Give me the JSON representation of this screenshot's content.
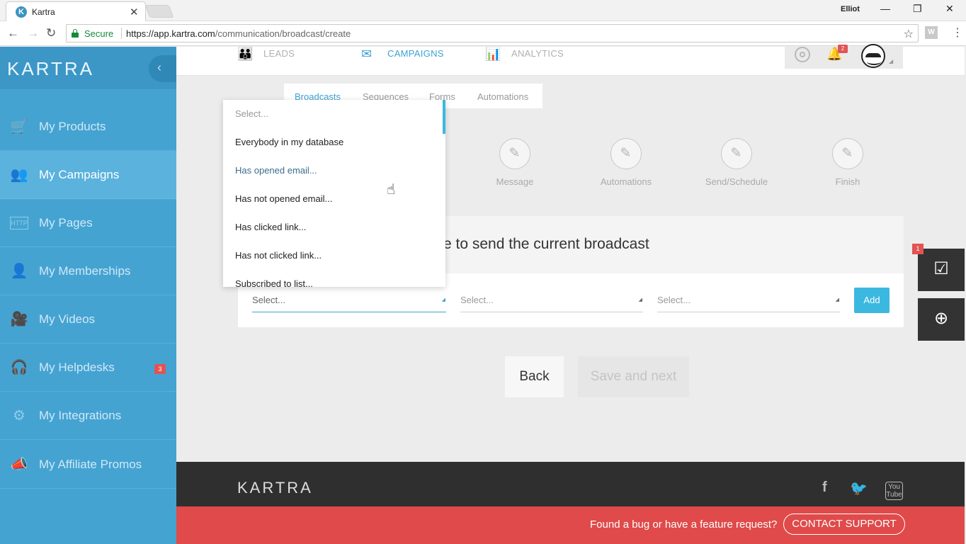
{
  "browser": {
    "tab_title": "Kartra",
    "tab_favicon_letter": "K",
    "profile_name": "Elliot",
    "secure_label": "Secure",
    "url_host": "https://app.kartra.com",
    "url_path": "/communication/broadcast/create",
    "ext_label": "W"
  },
  "sidebar": {
    "logo": "KARTRA",
    "items": [
      {
        "label": "My Products",
        "icon": "cart-icon",
        "active": false
      },
      {
        "label": "My Campaigns",
        "icon": "people-icon",
        "active": true
      },
      {
        "label": "My Pages",
        "icon": "http-page-icon",
        "active": false
      },
      {
        "label": "My Memberships",
        "icon": "member-icon",
        "active": false
      },
      {
        "label": "My Videos",
        "icon": "video-icon",
        "active": false
      },
      {
        "label": "My Helpdesks",
        "icon": "headset-icon",
        "active": false,
        "badge": "3"
      },
      {
        "label": "My Integrations",
        "icon": "gear-icon",
        "active": false
      },
      {
        "label": "My Affiliate Promos",
        "icon": "megaphone-icon",
        "active": false
      }
    ]
  },
  "topnav": {
    "items": [
      {
        "label": "LEADS",
        "icon": "leads-icon",
        "active": false
      },
      {
        "label": "CAMPAIGNS",
        "icon": "campaigns-icon",
        "active": true
      },
      {
        "label": "ANALYTICS",
        "icon": "analytics-icon",
        "active": false
      }
    ],
    "notification_count": "2"
  },
  "subtabs": [
    {
      "label": "Broadcasts",
      "active": true
    },
    {
      "label": "Sequences",
      "active": false
    },
    {
      "label": "Forms",
      "active": false
    },
    {
      "label": "Automations",
      "active": false
    }
  ],
  "steps": [
    {
      "label": "Message"
    },
    {
      "label": "Automations"
    },
    {
      "label": "Send/Schedule"
    },
    {
      "label": "Finish"
    }
  ],
  "card": {
    "title_visible": "e to send the current broadcast"
  },
  "selects": {
    "first": "Select...",
    "second": "Select...",
    "third": "Select...",
    "add_label": "Add"
  },
  "dropdown": {
    "options": [
      "Select...",
      "Everybody in my database",
      "Has opened email...",
      "Has not opened email...",
      "Has clicked link...",
      "Has not clicked link...",
      "Subscribed to list..."
    ]
  },
  "buttons": {
    "back": "Back",
    "save_next": "Save and next"
  },
  "float": {
    "checklist_badge": "1"
  },
  "footer": {
    "logo": "KARTRA",
    "bug_text": "Found a bug or have a feature request?",
    "support_label": "CONTACT SUPPORT",
    "youtube_label": "You Tube"
  },
  "colors": {
    "sidebar": "#45a3d2",
    "accent": "#3da2d3",
    "add_button": "#3bb8e0",
    "bug_bar": "#e04a4a",
    "footer": "#2f2f2f"
  }
}
